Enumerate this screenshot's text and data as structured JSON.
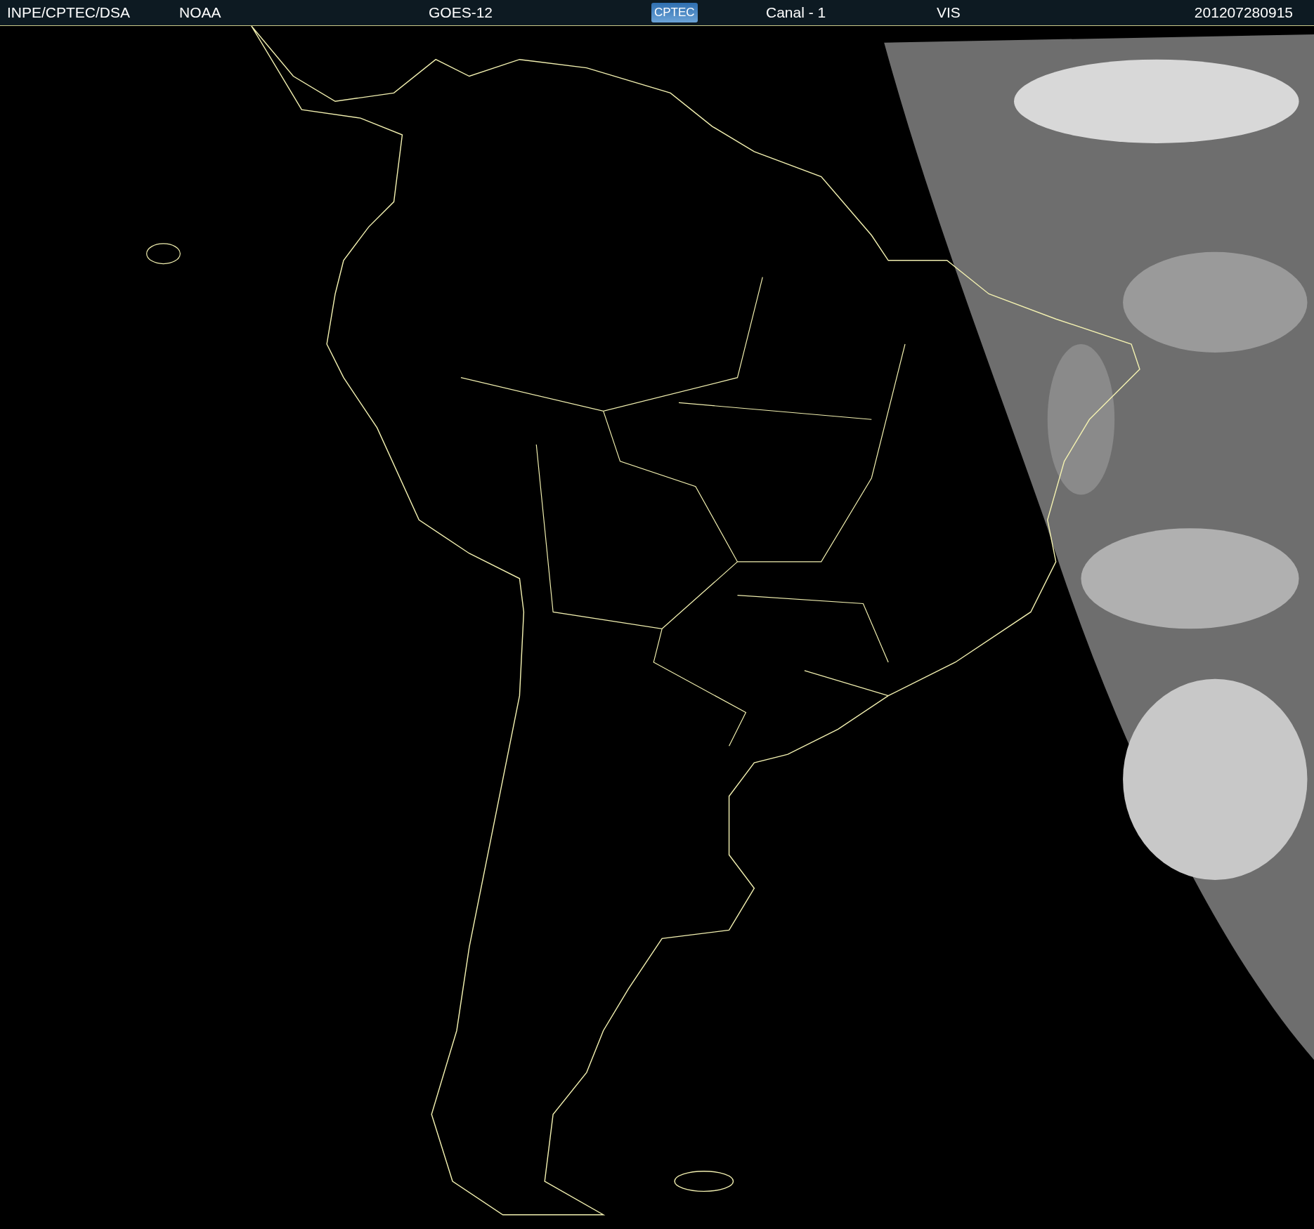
{
  "header": {
    "items": [
      {
        "kind": "text",
        "text": "INPE/CPTEC/DSA"
      },
      {
        "kind": "text",
        "text": "NOAA"
      },
      {
        "kind": "text",
        "text": "GOES-12"
      },
      {
        "kind": "logo",
        "text": "CPTEC"
      },
      {
        "kind": "text",
        "text": "Canal - 1"
      },
      {
        "kind": "text",
        "text": "VIS"
      },
      {
        "kind": "text",
        "text": "201207280915"
      }
    ]
  }
}
